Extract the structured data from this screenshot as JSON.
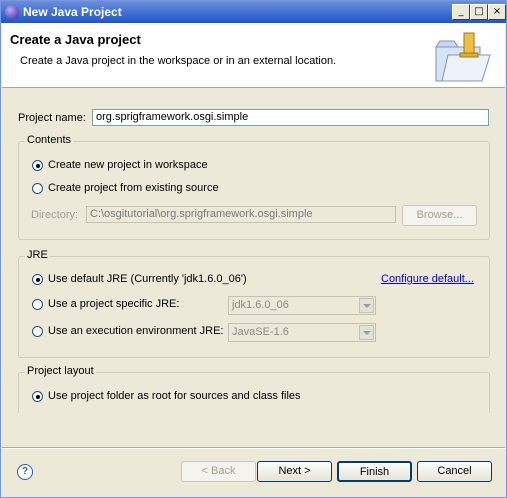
{
  "window": {
    "title": "New Java Project",
    "controls": {
      "minimize": "_",
      "maximize": "□",
      "close": "×"
    }
  },
  "header": {
    "title": "Create a Java project",
    "description": "Create a Java project in the workspace or in an external location."
  },
  "project_name": {
    "label": "Project name:",
    "value": "org.sprigframework.osgi.simple"
  },
  "contents": {
    "title": "Contents",
    "option_new": "Create new project in workspace",
    "option_existing": "Create project from existing source",
    "selected": "option_new",
    "directory_label": "Directory:",
    "directory_value": "C:\\osgitutorial\\org.sprigframework.osgi.simple",
    "browse_label": "Browse..."
  },
  "jre": {
    "title": "JRE",
    "option_default": "Use default JRE (Currently 'jdk1.6.0_06')",
    "configure_link": "Configure default...",
    "option_specific": "Use a project specific JRE:",
    "specific_value": "jdk1.6.0_06",
    "option_env": "Use an execution environment JRE:",
    "env_value": "JavaSE-1.6",
    "selected": "option_default"
  },
  "layout": {
    "title": "Project layout",
    "option_folder": "Use project folder as root for sources and class files"
  },
  "footer": {
    "help_icon": "?",
    "back": "< Back",
    "next": "Next >",
    "finish": "Finish",
    "cancel": "Cancel"
  },
  "colors": {
    "titlebar": "#1d55d0",
    "dialog_bg": "#ece9d8",
    "link": "#0000ff"
  }
}
